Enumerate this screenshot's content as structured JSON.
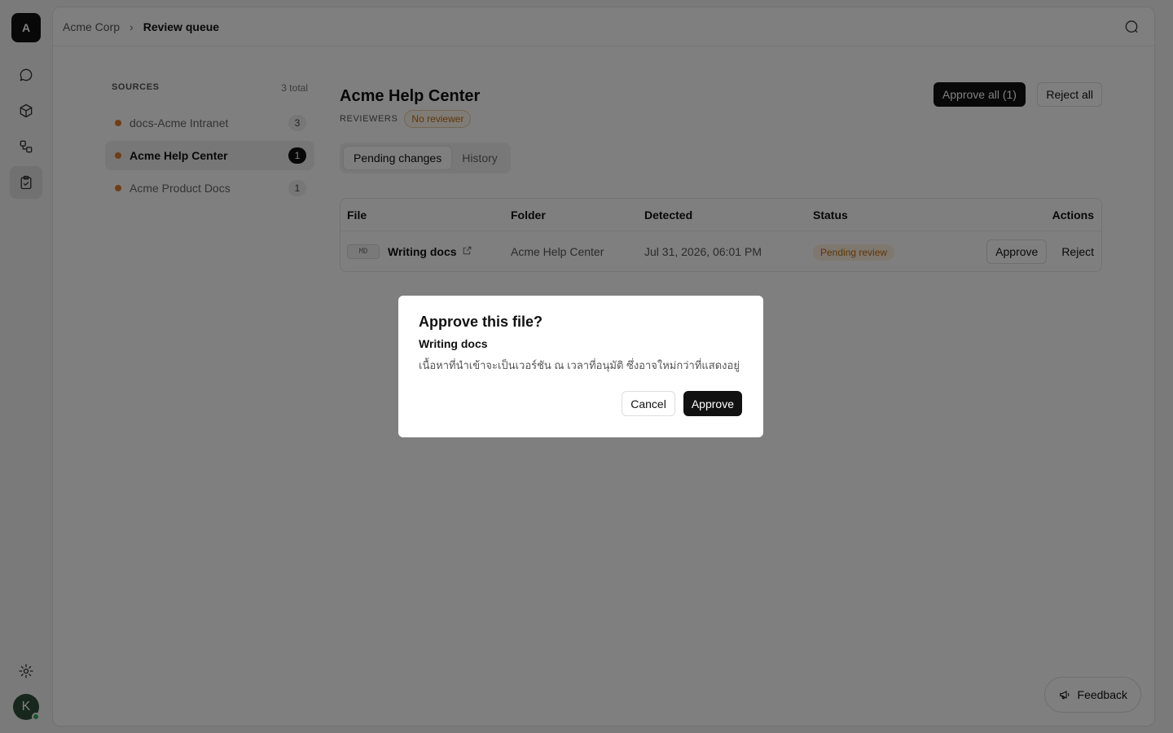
{
  "app": {
    "logo_letter": "A",
    "avatar_letter": "K"
  },
  "rail": {
    "items": [
      {
        "name": "chat-icon"
      },
      {
        "name": "cube-icon"
      },
      {
        "name": "workflow-icon"
      },
      {
        "name": "clipboard-check-icon",
        "active": true
      }
    ],
    "bottom": [
      {
        "name": "gear-icon"
      }
    ]
  },
  "breadcrumb": {
    "root": "Acme Corp",
    "separator": "›",
    "current": "Review queue"
  },
  "sources": {
    "title": "SOURCES",
    "total": "3 total",
    "items": [
      {
        "label": "docs-Acme Intranet",
        "count": "3"
      },
      {
        "label": "Acme Help Center",
        "count": "1",
        "active": true
      },
      {
        "label": "Acme Product Docs",
        "count": "1"
      }
    ]
  },
  "content": {
    "title": "Acme Help Center",
    "approve_all": "Approve all (1)",
    "reject_all": "Reject all",
    "reviewers_label": "REVIEWERS",
    "reviewer_badge": "No reviewer",
    "tabs": [
      {
        "label": "Pending changes",
        "active": true
      },
      {
        "label": "History"
      }
    ]
  },
  "table": {
    "headers": {
      "file": "File",
      "folder": "Folder",
      "detected": "Detected",
      "status": "Status",
      "actions": "Actions"
    },
    "rows": [
      {
        "type_badge": "MD",
        "file": "Writing docs",
        "folder": "Acme Help Center",
        "detected": "Jul 31, 2026, 06:01 PM",
        "status": "Pending review",
        "approve": "Approve",
        "reject": "Reject"
      }
    ]
  },
  "feedback": {
    "label": "Feedback"
  },
  "modal": {
    "title": "Approve this file?",
    "file": "Writing docs",
    "description": "เนื้อหาที่นำเข้าจะเป็นเวอร์ชัน ณ เวลาที่อนุมัติ ซึ่งอาจใหม่กว่าที่แสดงอยู่",
    "cancel": "Cancel",
    "approve": "Approve"
  },
  "colors": {
    "accent_dark": "#111111",
    "status_orange": "#c06a12",
    "source_dot": "#e07b2a"
  }
}
